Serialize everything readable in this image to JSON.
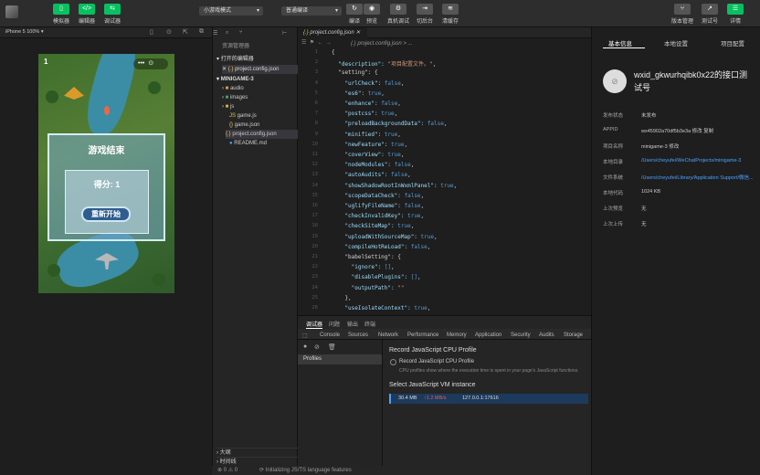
{
  "toolbar": {
    "left_buttons": [
      "模拟器",
      "编辑器",
      "调试器"
    ],
    "mode_select": "小游戏模式",
    "compile_select": "普通编译",
    "mid_buttons": [
      "编译",
      "预览",
      "真机调试",
      "切后台",
      "清缓存"
    ],
    "right_buttons": [
      "版本管理",
      "测试号",
      "详情"
    ]
  },
  "simulator": {
    "device": "iPhone 5 100% ▾",
    "level": "1",
    "game_over": "游戏结束",
    "score": "得分: 1",
    "restart": "重新开始"
  },
  "explorer": {
    "title": "资源管理器",
    "open_editors": "打开的编辑器",
    "open_file": "project.config.json",
    "project": "MINIGAME-3",
    "items": [
      "audio",
      "images",
      "js",
      "game.js",
      "game.json",
      "project.config.json",
      "README.md"
    ],
    "outline": "大纲",
    "timeline": "时间线"
  },
  "editor": {
    "tab": "project.config.json",
    "breadcrumb": "{.} project.config.json > ...",
    "lines": [
      [
        "{"
      ],
      [
        "  \"description\": ",
        "\"项目配置文件。\"",
        ","
      ],
      [
        "  \"setting\": {"
      ],
      [
        "    \"urlCheck\": ",
        "false",
        ","
      ],
      [
        "    \"es6\": ",
        "true",
        ","
      ],
      [
        "    \"enhance\": ",
        "false",
        ","
      ],
      [
        "    \"postcss\": ",
        "true",
        ","
      ],
      [
        "    \"preloadBackgroundData\": ",
        "false",
        ","
      ],
      [
        "    \"minified\": ",
        "true",
        ","
      ],
      [
        "    \"newFeature\": ",
        "true",
        ","
      ],
      [
        "    \"coverView\": ",
        "true",
        ","
      ],
      [
        "    \"nodeModules\": ",
        "false",
        ","
      ],
      [
        "    \"autoAudits\": ",
        "false",
        ","
      ],
      [
        "    \"showShadowRootInWxmlPanel\": ",
        "true",
        ","
      ],
      [
        "    \"scopeDataCheck\": ",
        "false",
        ","
      ],
      [
        "    \"uglifyFileName\": ",
        "false",
        ","
      ],
      [
        "    \"checkInvalidKey\": ",
        "true",
        ","
      ],
      [
        "    \"checkSiteMap\": ",
        "true",
        ","
      ],
      [
        "    \"uploadWithSourceMap\": ",
        "true",
        ","
      ],
      [
        "    \"compileHotReLoad\": ",
        "false",
        ","
      ],
      [
        "    \"babelSetting\": {"
      ],
      [
        "      \"ignore\": ",
        "[]",
        ","
      ],
      [
        "      \"disablePlugins\": ",
        "[]",
        ","
      ],
      [
        "      \"outputPath\": ",
        "\"\"",
        ""
      ],
      [
        "    },"
      ],
      [
        "    \"useIsolateContext\": ",
        "true",
        ","
      ]
    ]
  },
  "debugger": {
    "tabs": [
      "调试器",
      "问题",
      "输出",
      "终端"
    ],
    "devtabs": [
      "Console",
      "Sources",
      "Network",
      "Performance",
      "Memory",
      "Application",
      "Security",
      "Audits",
      "Storage"
    ],
    "profiles": "Profiles",
    "record_title": "Record JavaScript CPU Profile",
    "record_option": "Record JavaScript CPU Profile",
    "record_desc": "CPU profiles show where the execution time is spent in your page's JavaScript functions.",
    "vm_title": "Select JavaScript VM instance",
    "vm_mem": "30.4 MB",
    "vm_delta": "↑1.2 MB/s",
    "vm_addr": "127.0.0.1:17616"
  },
  "details": {
    "tabs": [
      "基本信息",
      "本地设置",
      "项目配置"
    ],
    "app_name": "wxid_gkwurhqibk0x22的接口测试号",
    "fields": [
      {
        "key": "发布状态",
        "value": "未发布"
      },
      {
        "key": "APPID",
        "value": "wx45902a70df5b3e3a 修改 复制"
      },
      {
        "key": "项目名称",
        "value": "minigame-3 修改"
      },
      {
        "key": "本地目录",
        "value": "/Users/cheyufei/WeChatProjects/minigame-3"
      },
      {
        "key": "文件系统",
        "value": "/Users/cheyufei/Library/Application Support/微信..."
      },
      {
        "key": "本地代码",
        "value": "1024 KB"
      },
      {
        "key": "上次预览",
        "value": "无"
      },
      {
        "key": "上次上传",
        "value": "无"
      }
    ]
  },
  "status": {
    "counts": "⊗ 0 ⚠ 0",
    "message": "Initializing JS/TS language features"
  }
}
